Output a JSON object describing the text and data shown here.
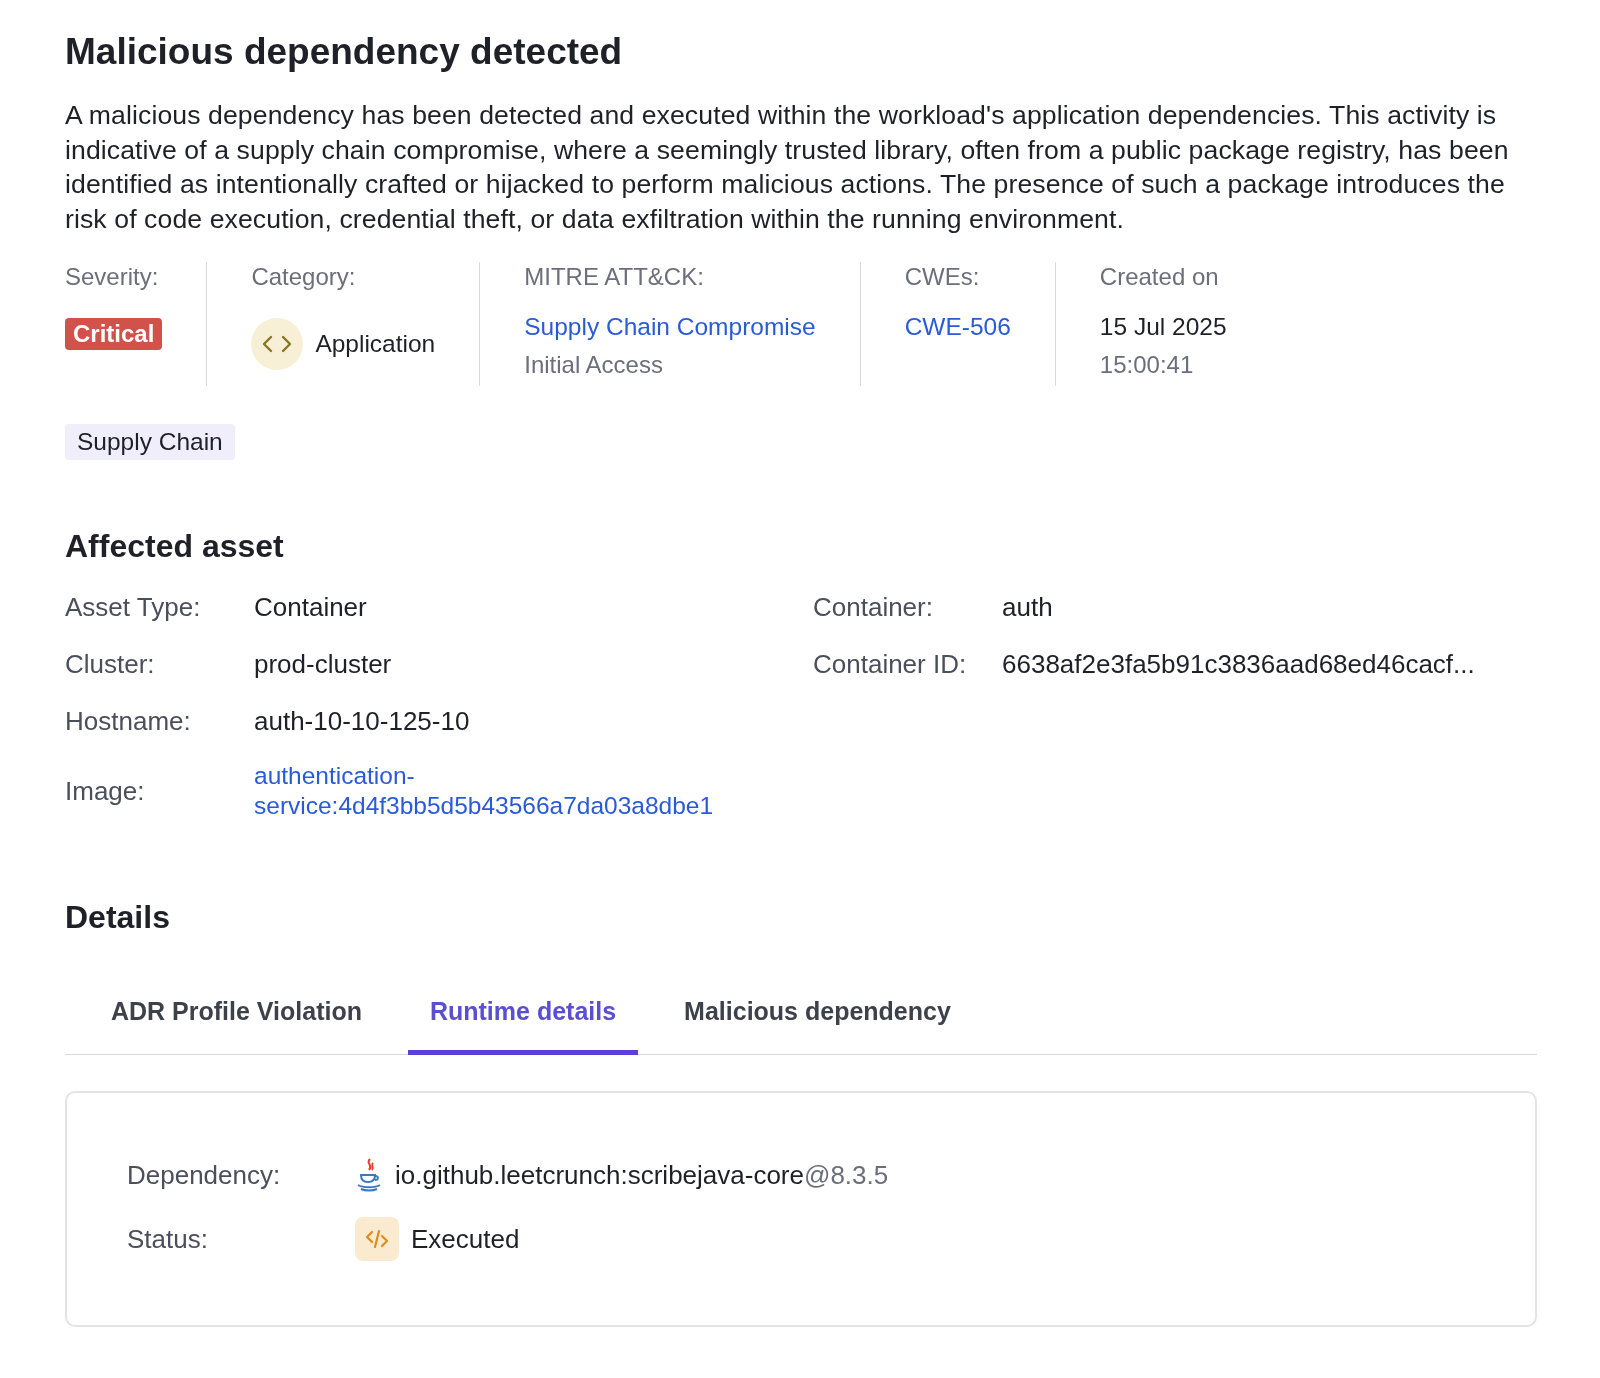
{
  "title": "Malicious dependency detected",
  "description": "A malicious dependency has been detected and executed within the workload's application dependencies. This activity is indicative of a supply chain compromise, where a seemingly trusted library, often from a public package registry, has been identified as intentionally crafted or hijacked to perform malicious actions. The presence of such a package introduces the risk of code execution, credential theft, or data exfiltration within the running environment.",
  "summary": {
    "severity": {
      "label": "Severity:",
      "value": "Critical",
      "color": "#d0524b"
    },
    "category": {
      "label": "Category:",
      "value": "Application"
    },
    "mitre": {
      "label": "MITRE ATT&CK:",
      "technique": "Supply Chain Compromise",
      "tactic": "Initial Access"
    },
    "cwes": {
      "label": "CWEs:",
      "value": "CWE-506"
    },
    "created": {
      "label": "Created on",
      "date": "15 Jul 2025",
      "time": "15:00:41"
    }
  },
  "tags": [
    "Supply Chain"
  ],
  "affected_asset": {
    "heading": "Affected asset",
    "left": [
      {
        "label": "Asset Type:",
        "value": "Container",
        "kind": "text"
      },
      {
        "label": "Cluster:",
        "value": "prod-cluster",
        "kind": "text"
      },
      {
        "label": "Hostname:",
        "value": "auth-10-10-125-10",
        "kind": "text"
      },
      {
        "label": "Image:",
        "value": "authentication-service:4d4f3bb5d5b43566a7da03a8dbe1",
        "kind": "link"
      }
    ],
    "right": [
      {
        "label": "Container:",
        "value": "auth"
      },
      {
        "label": "Container ID:",
        "value": "6638af2e3fa5b91c3836aad68ed46cacf..."
      }
    ]
  },
  "details": {
    "heading": "Details",
    "tabs": [
      {
        "label": "ADR Profile Violation",
        "selected": false
      },
      {
        "label": "Runtime details",
        "selected": true
      },
      {
        "label": "Malicious dependency",
        "selected": false
      }
    ],
    "dependency": {
      "label": "Dependency:",
      "name": "io.github.leetcrunch:scribejava-core",
      "version": "@8.3.5"
    },
    "status": {
      "label": "Status:",
      "value": "Executed"
    }
  }
}
